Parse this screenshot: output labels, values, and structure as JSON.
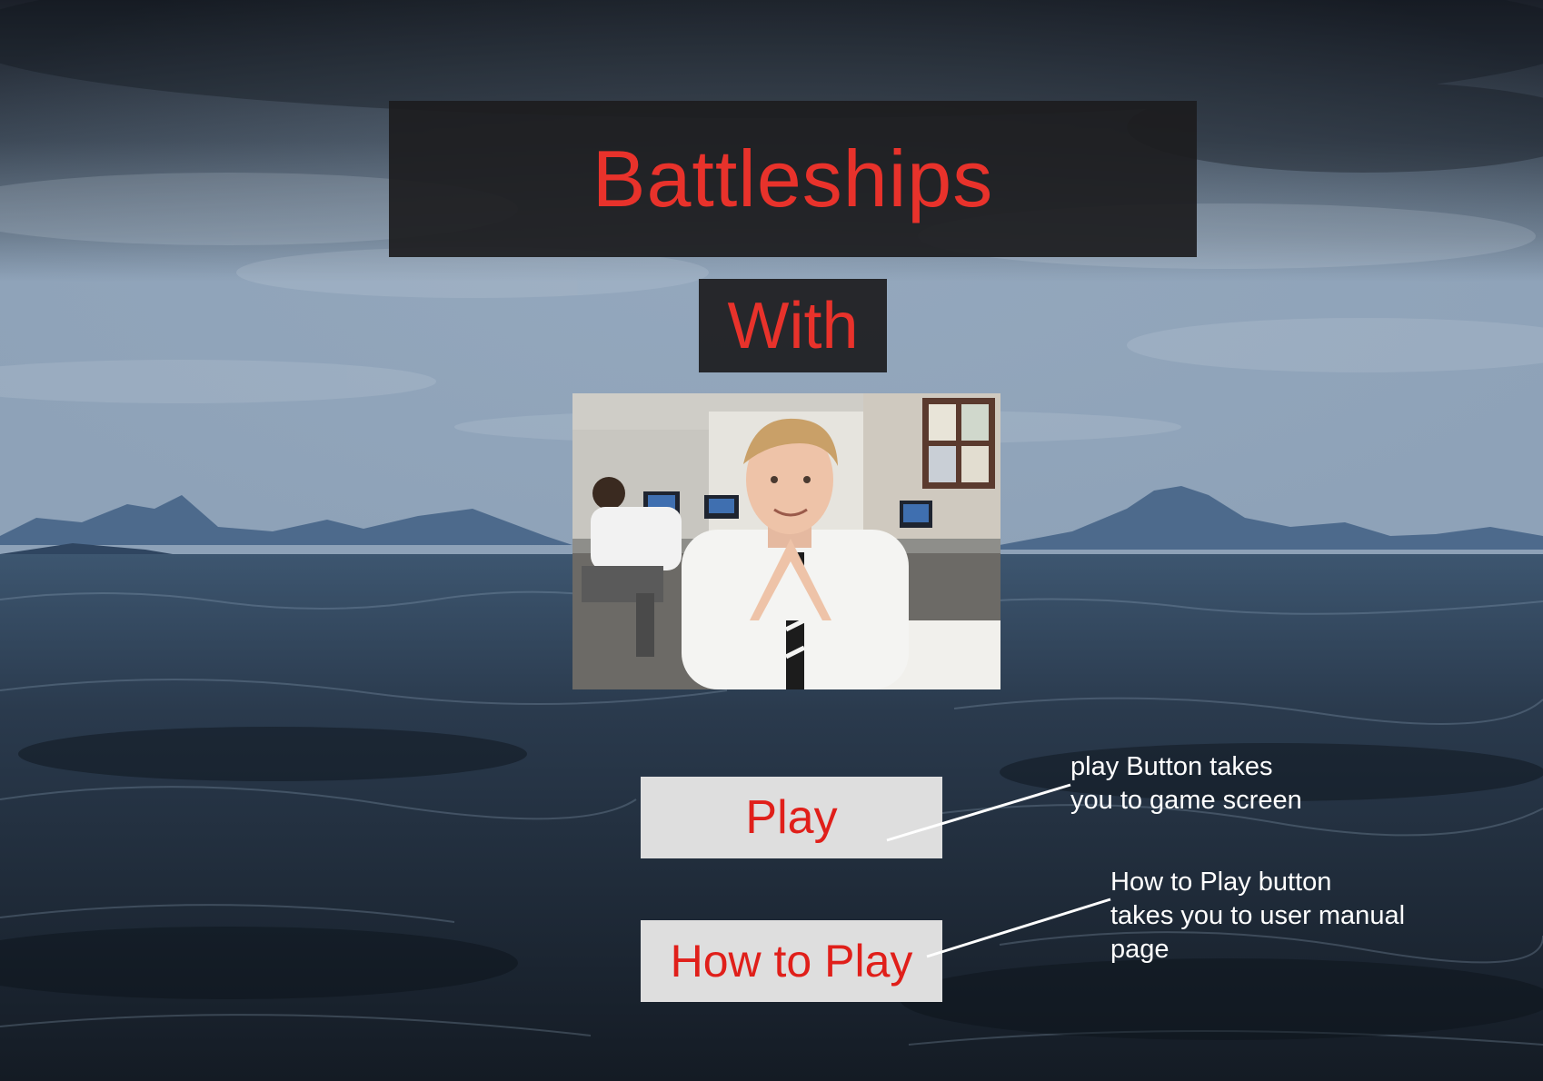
{
  "page": {
    "title": "Battleships",
    "subtitle": "With"
  },
  "buttons": {
    "play_label": "Play",
    "how_to_play_label": "How to Play"
  },
  "annotations": {
    "play_note": "play Button takes\nyou to game screen",
    "how_to_play_note": "How to Play button\ntakes you to user manual\npage"
  },
  "colors": {
    "title_text": "#e8322b",
    "button_text": "#e01f1a",
    "button_bg": "#dedede",
    "title_box_bg": "#1c1c1e",
    "annotation_text": "#ffffff"
  },
  "background": {
    "scene": "stormy-sea"
  }
}
